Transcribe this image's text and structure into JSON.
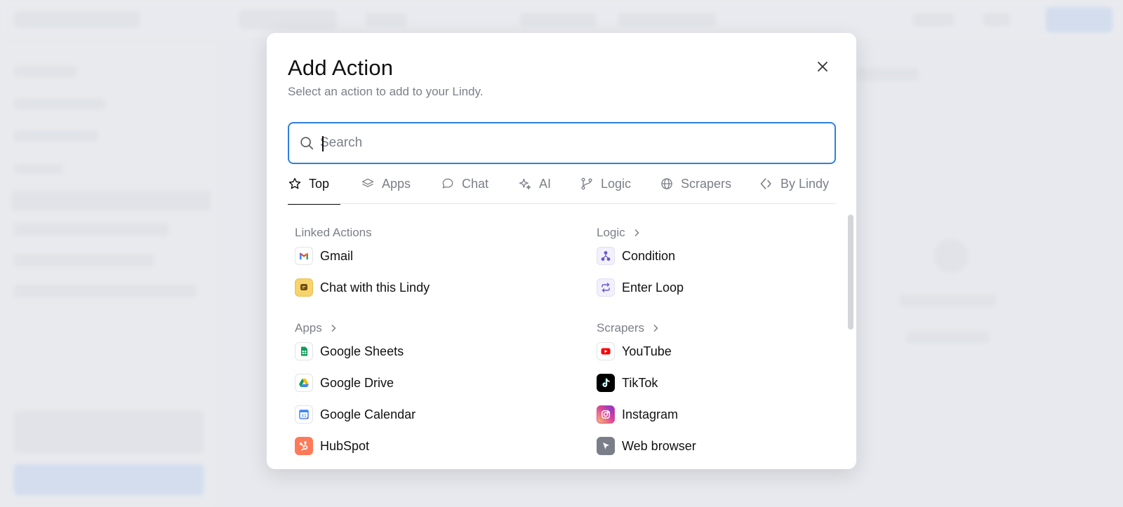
{
  "modal": {
    "title": "Add Action",
    "subtitle": "Select an action to add to your Lindy.",
    "close_icon": "close-icon"
  },
  "search": {
    "placeholder": "Search",
    "value": ""
  },
  "tabs": [
    {
      "label": "Top",
      "icon": "star-icon",
      "active": true
    },
    {
      "label": "Apps",
      "icon": "layers-icon",
      "active": false
    },
    {
      "label": "Chat",
      "icon": "chat-bubble-icon",
      "active": false
    },
    {
      "label": "AI",
      "icon": "sparkles-icon",
      "active": false
    },
    {
      "label": "Logic",
      "icon": "git-branch-icon",
      "active": false
    },
    {
      "label": "Scrapers",
      "icon": "globe-icon",
      "active": false
    },
    {
      "label": "By Lindy",
      "icon": "lindy-diamond-icon",
      "active": false
    }
  ],
  "sections": {
    "linked_actions": {
      "title": "Linked Actions",
      "items": [
        {
          "label": "Gmail",
          "icon": "gmail-icon"
        },
        {
          "label": "Chat with this Lindy",
          "icon": "chat-with-lindy-icon"
        }
      ]
    },
    "logic": {
      "title": "Logic",
      "items": [
        {
          "label": "Condition",
          "icon": "condition-icon"
        },
        {
          "label": "Enter Loop",
          "icon": "loop-icon"
        }
      ]
    },
    "apps": {
      "title": "Apps",
      "items": [
        {
          "label": "Google Sheets",
          "icon": "google-sheets-icon"
        },
        {
          "label": "Google Drive",
          "icon": "google-drive-icon"
        },
        {
          "label": "Google Calendar",
          "icon": "google-calendar-icon"
        },
        {
          "label": "HubSpot",
          "icon": "hubspot-icon"
        }
      ]
    },
    "scrapers": {
      "title": "Scrapers",
      "items": [
        {
          "label": "YouTube",
          "icon": "youtube-icon"
        },
        {
          "label": "TikTok",
          "icon": "tiktok-icon"
        },
        {
          "label": "Instagram",
          "icon": "instagram-icon"
        },
        {
          "label": "Web browser",
          "icon": "web-browser-icon"
        }
      ]
    }
  },
  "colors": {
    "accent": "#2f7fe0",
    "muted_text": "#7b7f87"
  }
}
